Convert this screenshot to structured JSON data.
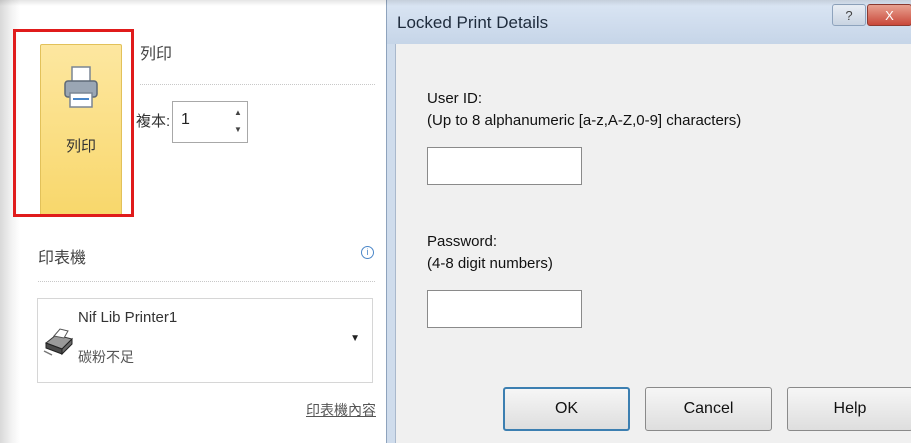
{
  "print_panel": {
    "print_button_label": "列印",
    "section_title": "列印",
    "copies_label": "複本:",
    "copies_value": "1",
    "printer_heading": "印表機",
    "selected_printer": {
      "name": "Nif Lib Printer1",
      "status": "碳粉不足"
    },
    "printer_properties_link": "印表機內容"
  },
  "dialog": {
    "title": "Locked Print Details",
    "title_help_glyph": "?",
    "title_close_glyph": "X",
    "user_id_label": "User ID:",
    "user_id_hint": "(Up to 8 alphanumeric [a-z,A-Z,0-9] characters)",
    "user_id_value": "",
    "password_label": "Password:",
    "password_hint": "(4-8 digit numbers)",
    "password_value": "",
    "buttons": {
      "ok": "OK",
      "cancel": "Cancel",
      "help": "Help"
    }
  },
  "colors": {
    "highlight_border": "#e01b1b",
    "print_tile": "#f8d76b",
    "dialog_frame": "#cfdcec"
  }
}
